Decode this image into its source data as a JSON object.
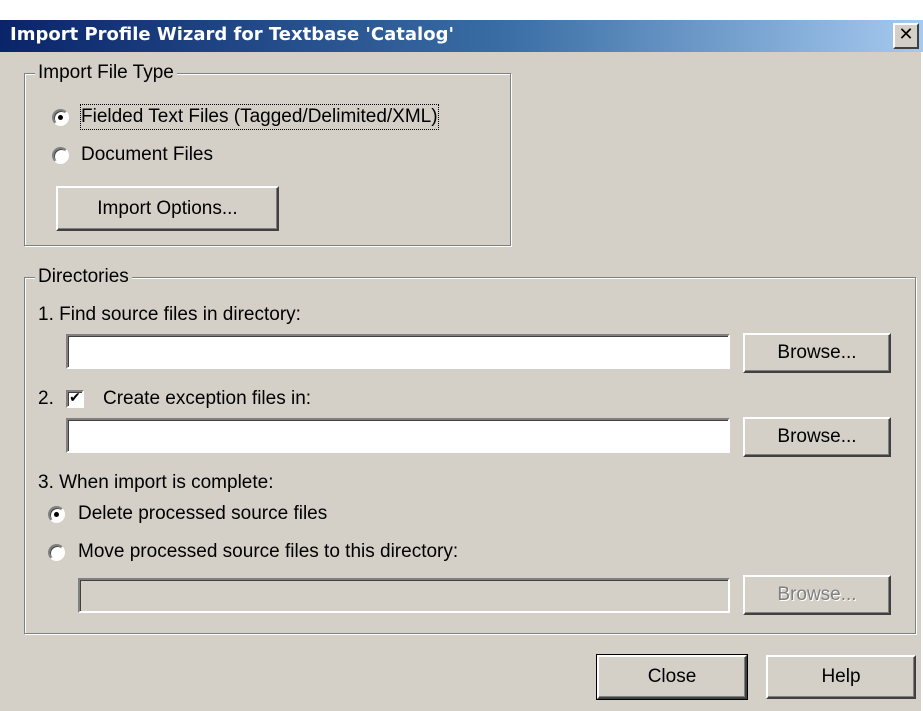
{
  "window": {
    "title": "Import Profile Wizard for Textbase 'Catalog'",
    "close_glyph": "✕"
  },
  "import_file_type": {
    "legend": "Import File Type",
    "options": [
      {
        "label": "Fielded Text Files (Tagged/Delimited/XML)",
        "selected": true
      },
      {
        "label": "Document Files",
        "selected": false
      }
    ],
    "import_options_button": "Import Options..."
  },
  "directories": {
    "legend": "Directories",
    "step1_label": "1. Find source files in directory:",
    "step1_value": "",
    "step2_prefix": "2.",
    "step2_label": "Create exception files in:",
    "step2_checked": true,
    "step2_value": "",
    "step3_label": "3. When import is complete:",
    "completion_options": [
      {
        "label": "Delete processed source files",
        "selected": true
      },
      {
        "label": "Move processed source files to this directory:",
        "selected": false
      }
    ],
    "move_dir_value": "",
    "browse_label": "Browse..."
  },
  "footer": {
    "close_label": "Close",
    "help_label": "Help"
  },
  "icons": {
    "checkmark": "✔"
  }
}
